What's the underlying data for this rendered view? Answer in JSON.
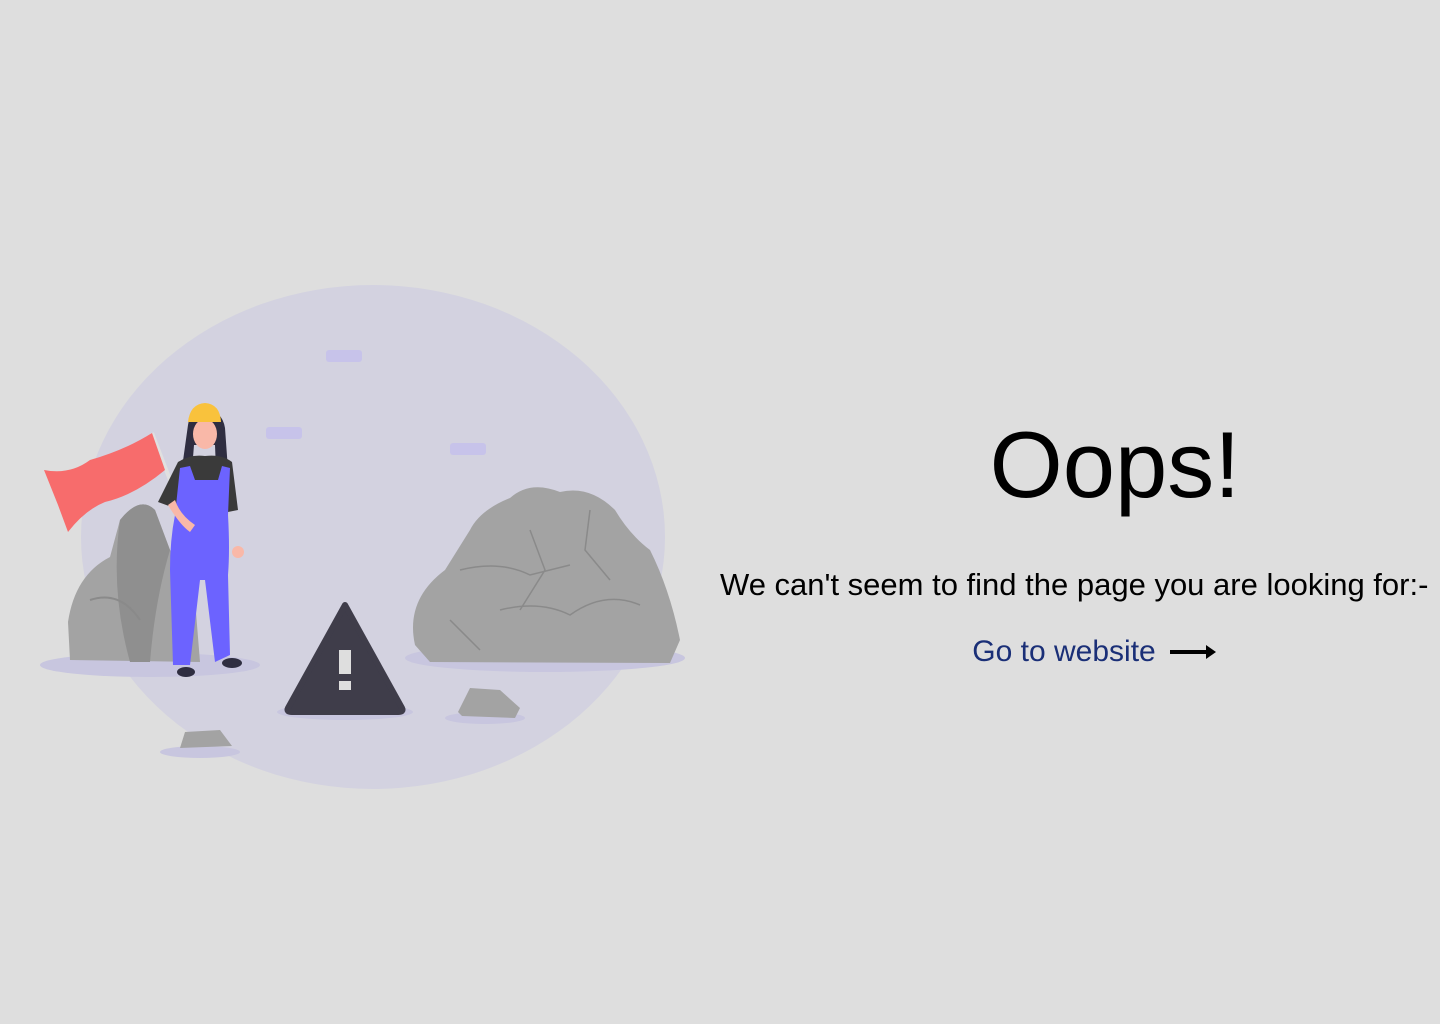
{
  "error": {
    "title": "Oops!",
    "message": "We can't seem to find the page you are looking for:-",
    "link_label": "Go to website"
  },
  "illustration": {
    "subject": "worker-with-flag-and-warning-sign",
    "colors": {
      "background": "#dedede",
      "circle": "#d3d2e0",
      "rock": "#a3a3a3",
      "rock_dark": "#8f8f8f",
      "flag": "#f76c6c",
      "overalls": "#6c63ff",
      "helmet": "#f9c23c",
      "warning": "#3f3d4a",
      "link": "#1a2f77"
    }
  }
}
